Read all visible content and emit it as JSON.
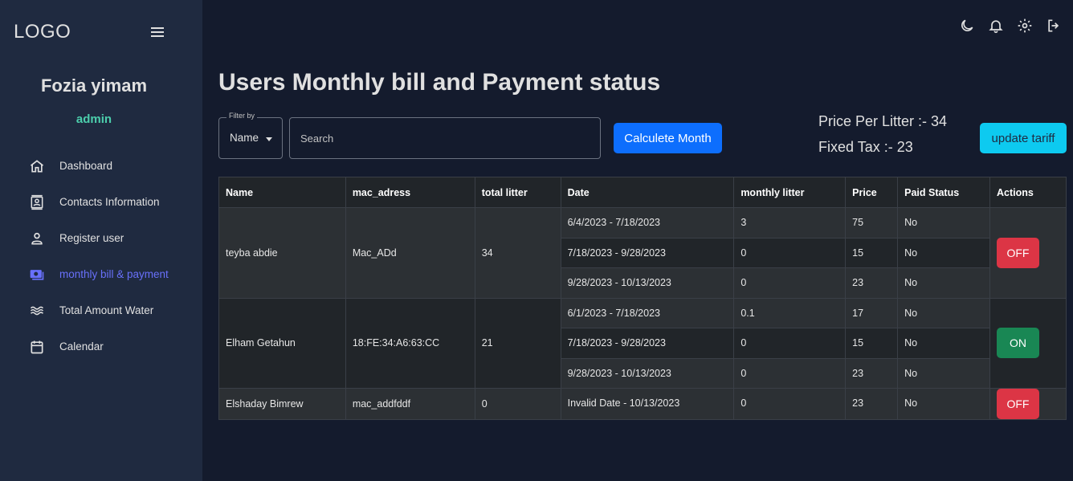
{
  "sidebar": {
    "logo": "LOGO",
    "profile_name": "Fozia yimam",
    "profile_role": "admin",
    "items": [
      {
        "label": "Dashboard",
        "icon": "home-icon"
      },
      {
        "label": "Contacts Information",
        "icon": "contacts-icon"
      },
      {
        "label": "Register user",
        "icon": "person-icon"
      },
      {
        "label": "monthly bill & payment",
        "icon": "payment-icon",
        "active": true
      },
      {
        "label": "Total Amount Water",
        "icon": "water-waves-icon"
      },
      {
        "label": "Calendar",
        "icon": "calendar-icon"
      }
    ],
    "active_color": "#6870fa"
  },
  "topbar": {
    "icons": [
      "dark-mode-icon",
      "notifications-icon",
      "settings-icon",
      "logout-icon"
    ]
  },
  "main": {
    "title": "Users Monthly bill and Payment status",
    "filter": {
      "legend": "Filter by",
      "value": "Name"
    },
    "search": {
      "placeholder": "Search",
      "value": ""
    },
    "calculate_button": "Calculete Month",
    "price_per_litter": "Price Per Litter :- 34",
    "fixed_tax": "Fixed Tax :- 23",
    "update_tariff_button": "update tariff"
  },
  "table": {
    "headers": [
      "Name",
      "mac_adress",
      "total litter",
      "Date",
      "monthly litter",
      "Price",
      "Paid Status",
      "Actions"
    ],
    "users": [
      {
        "name": "teyba abdie",
        "mac": "Mac_ADd",
        "total": "34",
        "action": "OFF",
        "months": [
          {
            "date": "6/4/2023 - 7/18/2023",
            "litter": "3",
            "price": "75",
            "paid": "No"
          },
          {
            "date": "7/18/2023 - 9/28/2023",
            "litter": "0",
            "price": "15",
            "paid": "No"
          },
          {
            "date": "9/28/2023 - 10/13/2023",
            "litter": "0",
            "price": "23",
            "paid": "No"
          }
        ]
      },
      {
        "name": "Elham Getahun",
        "mac": "18:FE:34:A6:63:CC",
        "total": "21",
        "action": "ON",
        "months": [
          {
            "date": "6/1/2023 - 7/18/2023",
            "litter": "0.1",
            "price": "17",
            "paid": "No"
          },
          {
            "date": "7/18/2023 - 9/28/2023",
            "litter": "0",
            "price": "15",
            "paid": "No"
          },
          {
            "date": "9/28/2023 - 10/13/2023",
            "litter": "0",
            "price": "23",
            "paid": "No"
          }
        ]
      },
      {
        "name": "Elshaday Bimrew",
        "mac": "mac_addfddf",
        "total": "0",
        "action": "OFF",
        "months": [
          {
            "date": "Invalid Date - 10/13/2023",
            "litter": "0",
            "price": "23",
            "paid": "No"
          }
        ]
      }
    ]
  },
  "colors": {
    "background": "#141b2d",
    "sidebar": "#1f2a40",
    "accent_green": "#4cceac",
    "primary_button": "#0d6efd",
    "info_button": "#0dcaf0",
    "off_button": "#dc3545",
    "on_button": "#198754"
  }
}
